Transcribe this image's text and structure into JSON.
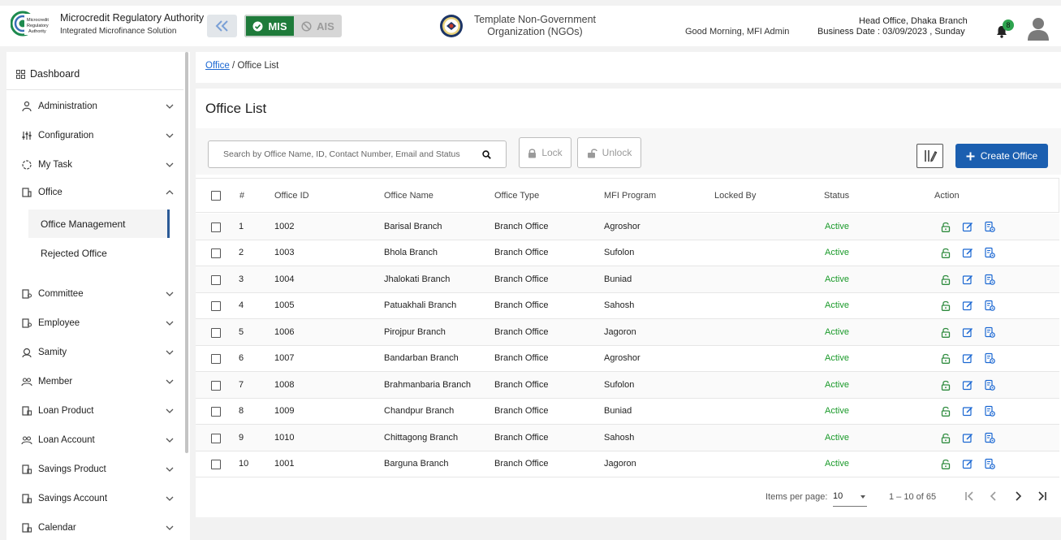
{
  "header": {
    "brand_title": "Microcredit Regulatory Authority",
    "brand_subtitle": "Integrated Microfinance Solution",
    "logo_text": "Microcredit Regulatory Authority",
    "mode_mis": "MIS",
    "mode_ais": "AIS",
    "org_name": "Template Non-Government Organization (NGOs)",
    "greeting": "Good Morning, MFI Admin",
    "branch": "Head Office, Dhaka Branch",
    "business_date": "Business Date : 03/09/2023 , Sunday",
    "notification_count": "8"
  },
  "sidebar": {
    "dashboard": "Dashboard",
    "items": [
      {
        "label": "Administration",
        "icon": "admin-icon"
      },
      {
        "label": "Configuration",
        "icon": "config-icon"
      },
      {
        "label": "My Task",
        "icon": "task-icon"
      },
      {
        "label": "Office",
        "icon": "office-icon"
      },
      {
        "label": "Committee",
        "icon": "committee-icon"
      },
      {
        "label": "Employee",
        "icon": "employee-icon"
      },
      {
        "label": "Samity",
        "icon": "samity-icon"
      },
      {
        "label": "Member",
        "icon": "member-icon"
      },
      {
        "label": "Loan Product",
        "icon": "loan-product-icon"
      },
      {
        "label": "Loan Account",
        "icon": "loan-account-icon"
      },
      {
        "label": "Savings Product",
        "icon": "savings-product-icon"
      },
      {
        "label": "Savings Account",
        "icon": "savings-account-icon"
      },
      {
        "label": "Calendar",
        "icon": "calendar-icon"
      }
    ],
    "office_sub": [
      "Office Management",
      "Rejected Office"
    ]
  },
  "breadcrumb": {
    "parent": "Office",
    "separator": "/",
    "current": "Office List"
  },
  "page": {
    "title": "Office List",
    "search_placeholder": "Search by Office Name, ID, Contact Number, Email and Status",
    "lock_label": "Lock",
    "unlock_label": "Unlock",
    "create_label": "Create Office"
  },
  "table": {
    "headers": [
      "#",
      "Office ID",
      "Office Name",
      "Office Type",
      "MFI Program",
      "Locked By",
      "Status",
      "Action"
    ],
    "rows": [
      {
        "n": "1",
        "id": "1002",
        "name": "Barisal Branch",
        "type": "Branch Office",
        "program": "Agroshor",
        "locked_by": "",
        "status": "Active"
      },
      {
        "n": "2",
        "id": "1003",
        "name": "Bhola Branch",
        "type": "Branch Office",
        "program": "Sufolon",
        "locked_by": "",
        "status": "Active"
      },
      {
        "n": "3",
        "id": "1004",
        "name": "Jhalokati Branch",
        "type": "Branch Office",
        "program": "Buniad",
        "locked_by": "",
        "status": "Active"
      },
      {
        "n": "4",
        "id": "1005",
        "name": "Patuakhali Branch",
        "type": "Branch Office",
        "program": "Sahosh",
        "locked_by": "",
        "status": "Active"
      },
      {
        "n": "5",
        "id": "1006",
        "name": "Pirojpur Branch",
        "type": "Branch Office",
        "program": "Jagoron",
        "locked_by": "",
        "status": "Active"
      },
      {
        "n": "6",
        "id": "1007",
        "name": "Bandarban Branch",
        "type": "Branch Office",
        "program": "Agroshor",
        "locked_by": "",
        "status": "Active"
      },
      {
        "n": "7",
        "id": "1008",
        "name": "Brahmanbaria Branch",
        "type": "Branch Office",
        "program": "Sufolon",
        "locked_by": "",
        "status": "Active"
      },
      {
        "n": "8",
        "id": "1009",
        "name": "Chandpur Branch",
        "type": "Branch Office",
        "program": "Buniad",
        "locked_by": "",
        "status": "Active"
      },
      {
        "n": "9",
        "id": "1010",
        "name": "Chittagong Branch",
        "type": "Branch Office",
        "program": "Sahosh",
        "locked_by": "",
        "status": "Active"
      },
      {
        "n": "10",
        "id": "1001",
        "name": "Barguna Branch",
        "type": "Branch Office",
        "program": "Jagoron",
        "locked_by": "",
        "status": "Active"
      }
    ]
  },
  "paginator": {
    "items_per_page_label": "Items per page:",
    "page_size": "10",
    "range": "1 – 10 of 65"
  },
  "colors": {
    "primary": "#1b5fb0",
    "mis_green": "#1e7b3a",
    "status_active": "#1a9a2a",
    "action_green": "#2e8b3e",
    "action_blue": "#1a67d2"
  }
}
